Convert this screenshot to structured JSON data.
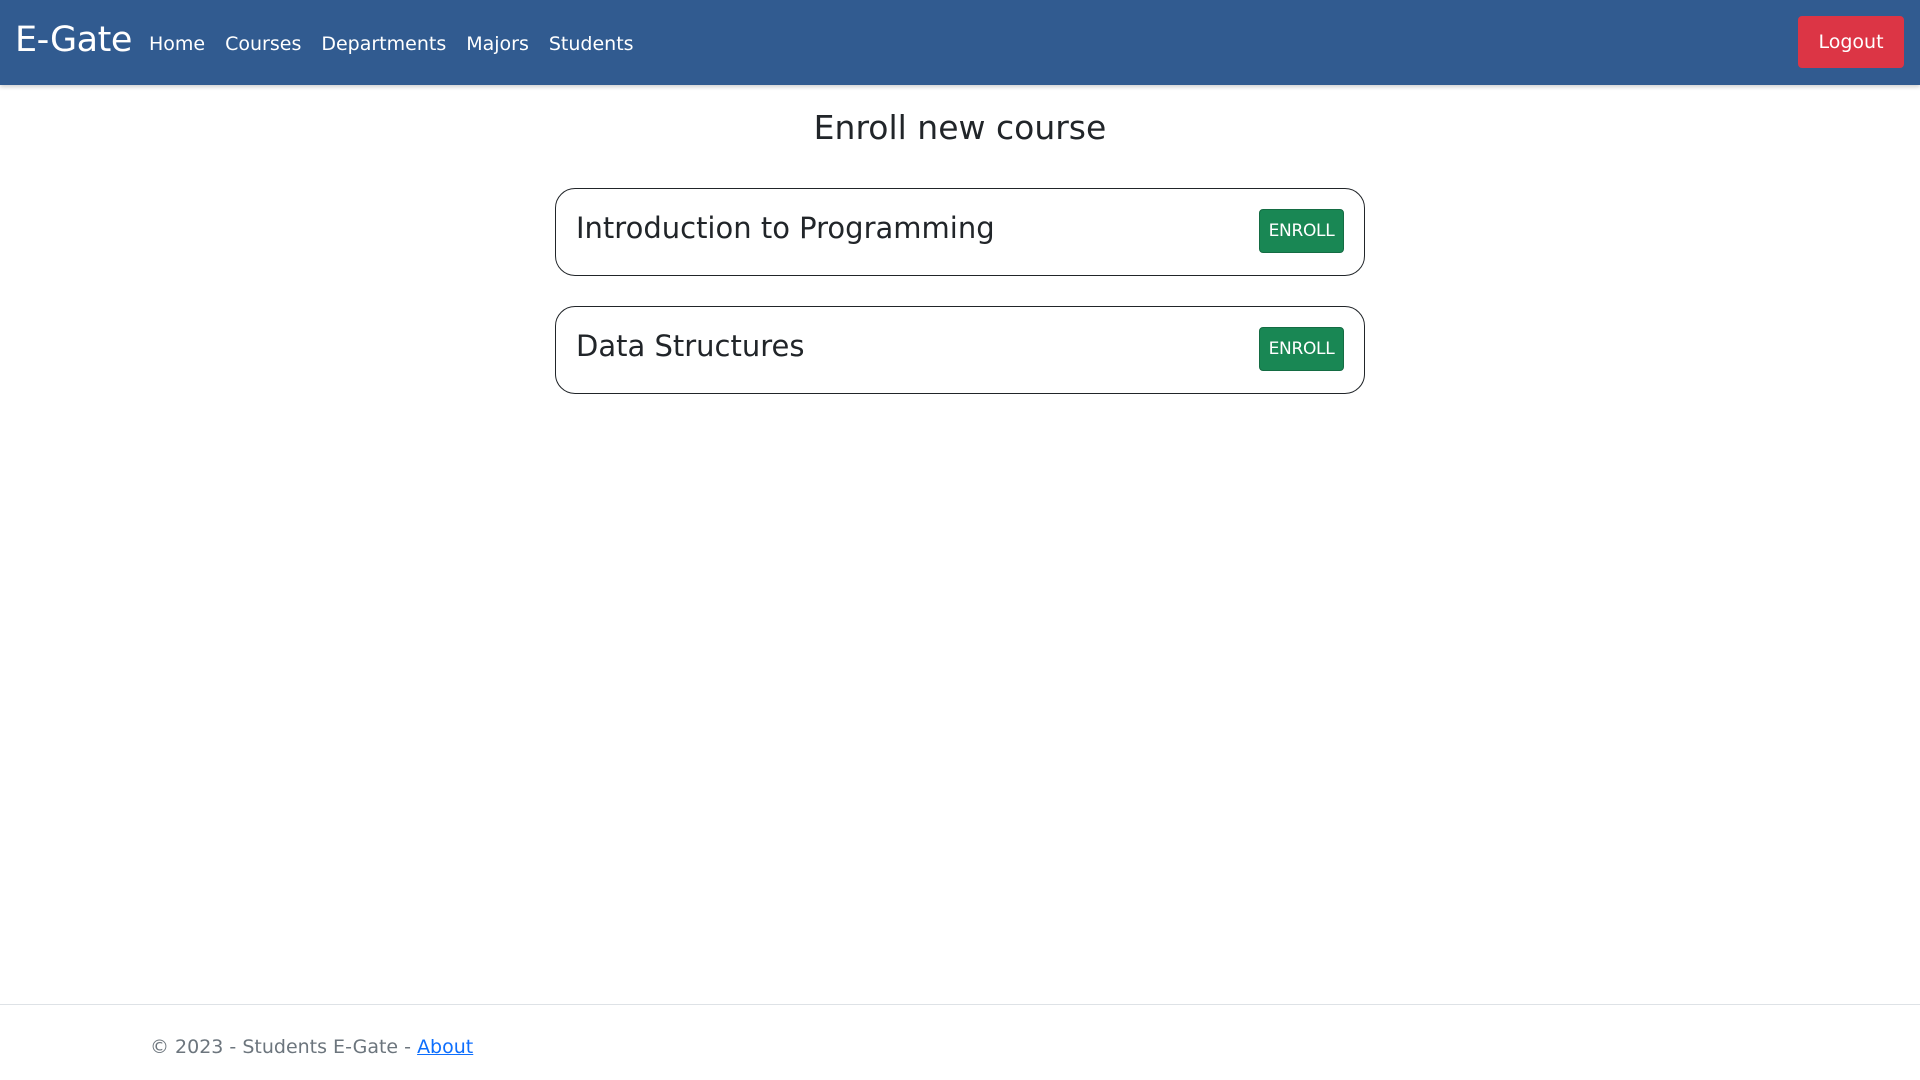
{
  "navbar": {
    "brand": "E-Gate",
    "links": [
      "Home",
      "Courses",
      "Departments",
      "Majors",
      "Students"
    ],
    "logout_label": "Logout",
    "background_color": "#315b90",
    "logout_color": "#dc3545"
  },
  "main": {
    "title": "Enroll new course",
    "courses": [
      {
        "name": "Introduction to Programming",
        "action_label": "ENROLL"
      },
      {
        "name": "Data Structures",
        "action_label": "ENROLL"
      }
    ],
    "enroll_color": "#198754"
  },
  "footer": {
    "text": "© 2023 - Students E-Gate - ",
    "about_label": "About"
  }
}
